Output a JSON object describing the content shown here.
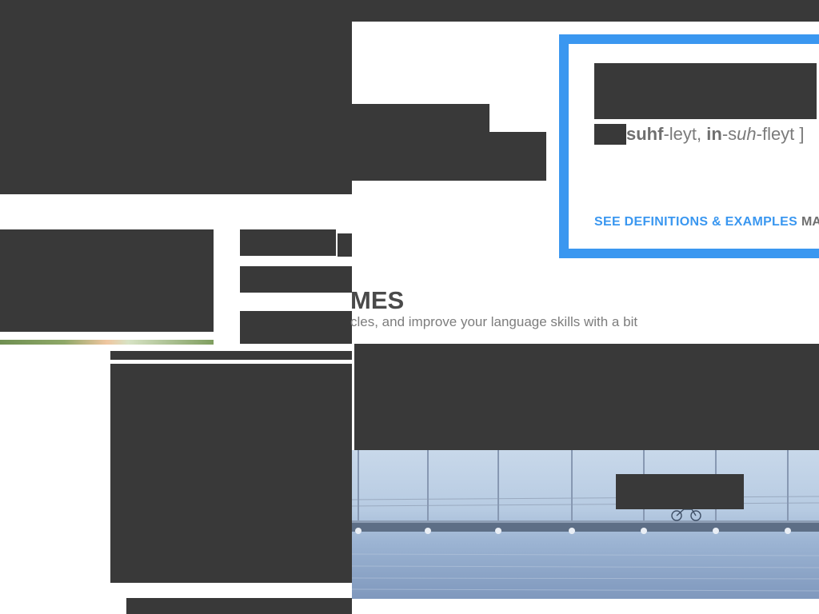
{
  "word_of_the_day": {
    "pronunciation": {
      "p1": "suhf",
      "p2": "-leyt, ",
      "p3": "in",
      "p4": "-s",
      "p5": "uh",
      "p6": "-fleyt ]"
    },
    "see_definitions_label": "SEE DEFINITIONS & EXAMPLES",
    "more_label": "MA"
  },
  "games": {
    "title_fragment": "MES",
    "subtitle_fragment": "cles, and improve your language skills with a bit"
  },
  "colors": {
    "accent": "#3a97f0",
    "redaction": "#393939"
  }
}
